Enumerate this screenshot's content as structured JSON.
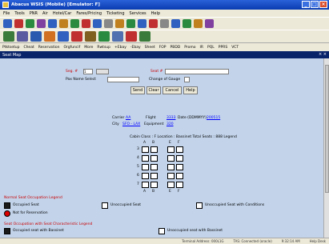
{
  "window": {
    "title": "Abacus WSIS (Mobile) [Emulator: F]"
  },
  "menu": [
    "File",
    "Tools",
    "PNR",
    "Air",
    "Hotel/Car",
    "Fares/Pricing",
    "Ticketing",
    "Services",
    "Help"
  ],
  "nav": [
    "Ptktsetup",
    "Cheat",
    "Reservation",
    "Orgfuncif",
    "More",
    "Rwtsup",
    "+Ebay",
    "-Ebay",
    "Sheet",
    "FOP",
    "PBDD",
    "Promo",
    "IR",
    "PQL",
    "PPRS",
    "VCT"
  ],
  "panel": {
    "title": "Seat Map"
  },
  "form": {
    "seg_label": "Seg. #",
    "seg_value": "1",
    "seat_label": "Seat #",
    "seat_value": "",
    "pax_label": "Pax Name Select",
    "pax_value": "",
    "gauge_label": "Change of Gauge",
    "send": "Send",
    "clear": "Clear",
    "cancel": "Cancel",
    "help": "Help"
  },
  "flight": {
    "carrier_label": "Carrier",
    "carrier": "AA",
    "flight_label": "Flight",
    "flight": "3333",
    "date_label": "Date (DDMMYY)",
    "date": "200515",
    "city_label": "City",
    "city": "SFO - LAX",
    "equip_label": "Equipment",
    "equip": "320"
  },
  "cabin_line": "Cabin Class : F  Location : Bassinet  Total Seats : 888  Legend",
  "columns_top": [
    "A",
    "B",
    "E",
    "F"
  ],
  "columns_bottom": [
    "A",
    "B",
    "E",
    "F"
  ],
  "rows": [
    "3",
    "4",
    "5",
    "6",
    "7"
  ],
  "legend": {
    "normal_title": "Normal Seat Occupation Legend",
    "occupied": "Occupied Seat",
    "unoccupied": "Unoccupied Seat",
    "unoccupied_cond": "Unoccupied Seat with Conditions",
    "not_reservation": "Not for Reservation",
    "special_title": "Seat Occupation with Seat Characteristic Legend",
    "occ_bassinet": "Occupied seat with Bassinet",
    "unocc_bassinet": "Unoccupied seat with Bassinet"
  },
  "status": [
    "Terminal Address: 000L1G",
    "TAS: Connected (oracle)",
    "9:32:14 AM",
    "Help Desk"
  ]
}
